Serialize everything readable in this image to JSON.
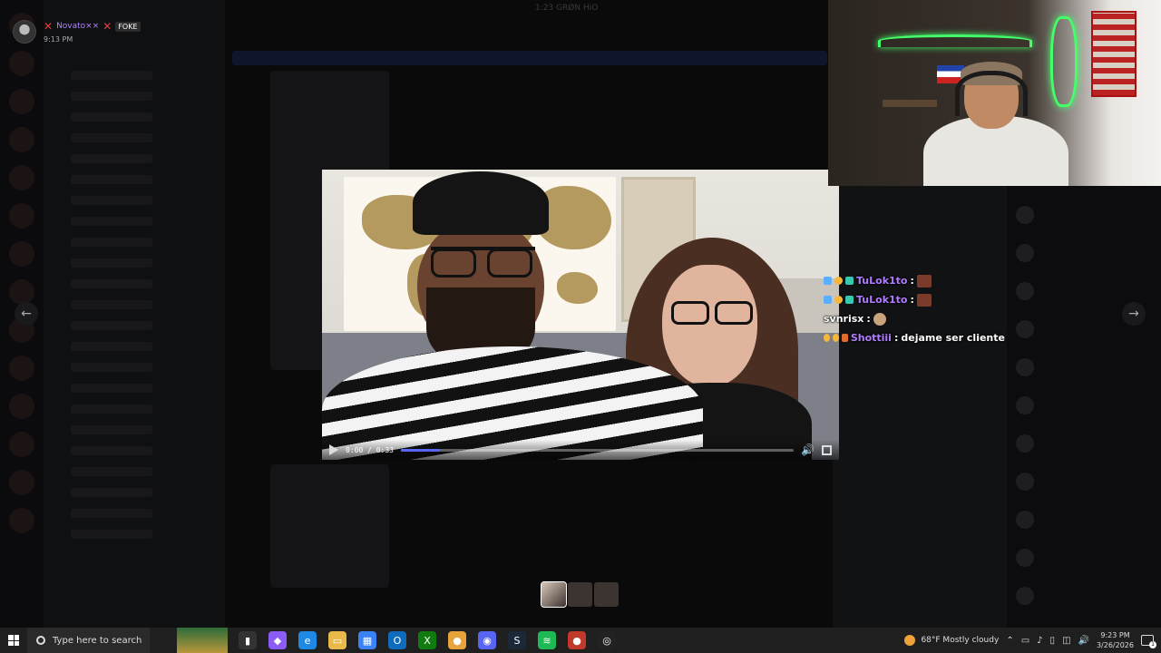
{
  "overlay": {
    "username": "Novato××",
    "badge": "FOKE",
    "time": "9:13 PM",
    "window_title": "1:23 GRØN HiO"
  },
  "video": {
    "time_display": "0:00 / 0:33",
    "progress": 0.0,
    "buffered": 0.1
  },
  "chat": [
    {
      "user": "TuLok1to",
      "separator": ":",
      "message": "",
      "user_color": "#b27cff",
      "badges": [
        "#5ab0ff",
        "#f6b73c",
        "#37c8b0"
      ],
      "emote": "emote"
    },
    {
      "user": "TuLok1to",
      "separator": ":",
      "message": "",
      "user_color": "#b27cff",
      "badges": [
        "#5ab0ff",
        "#f6b73c",
        "#37c8b0"
      ],
      "emote": "emote"
    },
    {
      "user": "svnrisx",
      "separator": ":",
      "message": "",
      "user_color": "#ffffff",
      "badges": [],
      "emote": "emote2"
    },
    {
      "user": "Shottiii",
      "separator": ":",
      "message": "dejame ser cliente",
      "user_color": "#b27cff",
      "badges": [
        "#f6b73c",
        "#f6b73c",
        "#e06d2f"
      ],
      "emote": ""
    }
  ],
  "taskbar": {
    "search_placeholder": "Type here to search",
    "weather": "68°F  Mostly cloudy",
    "time": "9:23 PM",
    "date": "3/26/2026",
    "notification_count": "1",
    "icons": [
      {
        "name": "task-view-icon",
        "color": "#333",
        "glyph": "▮"
      },
      {
        "name": "copilot-icon",
        "color": "#8b5cf6",
        "glyph": "◆"
      },
      {
        "name": "edge-icon",
        "color": "#1e88e5",
        "glyph": "e"
      },
      {
        "name": "file-explorer-icon",
        "color": "#e9b949",
        "glyph": "▭"
      },
      {
        "name": "store-icon",
        "color": "#3b82f6",
        "glyph": "▦"
      },
      {
        "name": "outlook-icon",
        "color": "#0f6cbd",
        "glyph": "O"
      },
      {
        "name": "xbox-icon",
        "color": "#107c10",
        "glyph": "X"
      },
      {
        "name": "chrome-icon",
        "color": "#e8a33a",
        "glyph": "●"
      },
      {
        "name": "discord-icon",
        "color": "#5865f2",
        "glyph": "◉"
      },
      {
        "name": "steam-icon",
        "color": "#1b2838",
        "glyph": "S"
      },
      {
        "name": "spotify-icon",
        "color": "#1db954",
        "glyph": "≋"
      },
      {
        "name": "chrome-profile-icon",
        "color": "#c0392b",
        "glyph": "●"
      },
      {
        "name": "obs-icon",
        "color": "#222",
        "glyph": "◎"
      }
    ]
  },
  "colors": {
    "accent": "#5865f2",
    "chat_purple": "#b27cff",
    "neon_green": "#43ff6a"
  }
}
